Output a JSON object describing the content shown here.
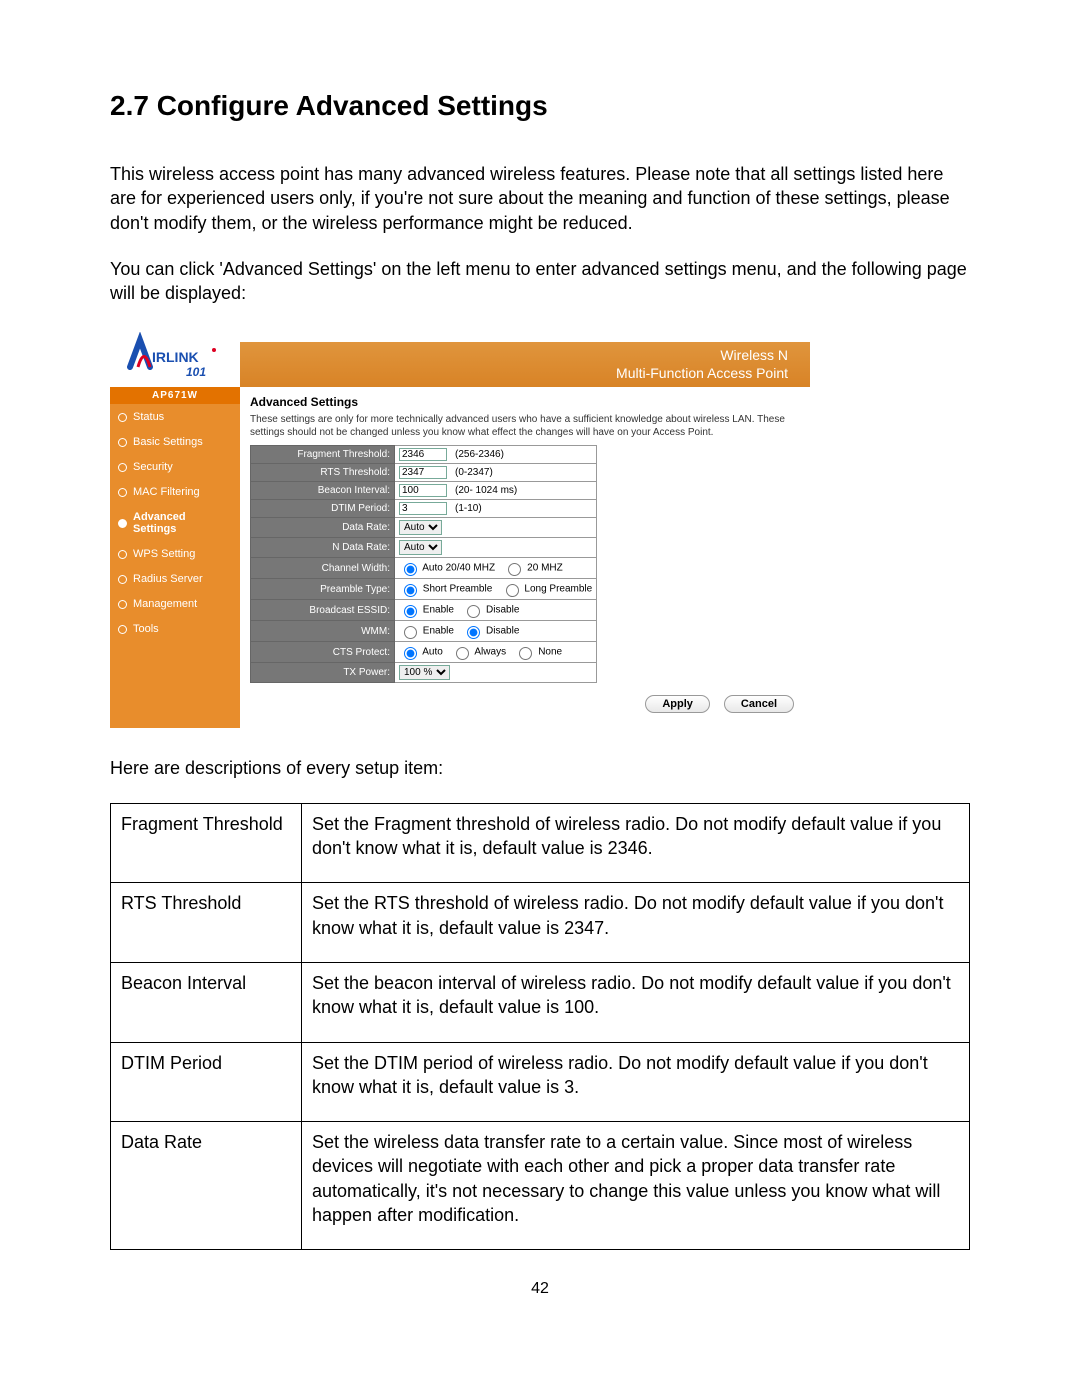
{
  "section": {
    "title": "2.7 Configure Advanced Settings",
    "p1": "This wireless access point has many advanced wireless features. Please note that all settings listed here are for experienced users only, if you're not sure about the meaning and function of these settings, please don't modify them, or the wireless performance might be reduced.",
    "p2": "You can click 'Advanced Settings' on the left menu to enter advanced settings menu, and the following page will be displayed:",
    "p3": "Here are descriptions of every setup item:",
    "pagenum": "42"
  },
  "router": {
    "brand_line1": "Wireless N",
    "brand_line2": "Multi-Function Access Point",
    "model": "AP671W",
    "nav": [
      {
        "label": "Status",
        "active": false
      },
      {
        "label": "Basic Settings",
        "active": false
      },
      {
        "label": "Security",
        "active": false
      },
      {
        "label": "MAC Filtering",
        "active": false
      },
      {
        "label": "Advanced Settings",
        "active": true
      },
      {
        "label": "WPS Setting",
        "active": false
      },
      {
        "label": "Radius Server",
        "active": false
      },
      {
        "label": "Management",
        "active": false
      },
      {
        "label": "Tools",
        "active": false
      }
    ],
    "content": {
      "heading": "Advanced Settings",
      "desc": "These settings are only for more technically advanced users who have a sufficient knowledge about wireless LAN. These settings should not be changed unless you know what effect the changes will have on your Access Point.",
      "rows": {
        "frag_label": "Fragment Threshold:",
        "frag_value": "2346",
        "frag_hint": "(256-2346)",
        "rts_label": "RTS Threshold:",
        "rts_value": "2347",
        "rts_hint": "(0-2347)",
        "beacon_label": "Beacon Interval:",
        "beacon_value": "100",
        "beacon_hint": "(20- 1024 ms)",
        "dtim_label": "DTIM Period:",
        "dtim_value": "3",
        "dtim_hint": "(1-10)",
        "data_label": "Data Rate:",
        "data_value": "Auto",
        "ndata_label": "N Data Rate:",
        "ndata_value": "Auto",
        "chw_label": "Channel Width:",
        "chw_opt1": "Auto 20/40 MHZ",
        "chw_opt2": "20 MHZ",
        "pre_label": "Preamble Type:",
        "pre_opt1": "Short Preamble",
        "pre_opt2": "Long Preamble",
        "bssid_label": "Broadcast ESSID:",
        "bssid_opt1": "Enable",
        "bssid_opt2": "Disable",
        "wmm_label": "WMM:",
        "wmm_opt1": "Enable",
        "wmm_opt2": "Disable",
        "cts_label": "CTS Protect:",
        "cts_opt1": "Auto",
        "cts_opt2": "Always",
        "cts_opt3": "None",
        "tx_label": "TX Power:",
        "tx_value": "100 %"
      },
      "apply": "Apply",
      "cancel": "Cancel"
    }
  },
  "table": [
    {
      "name": "Fragment Threshold",
      "desc": "Set the Fragment threshold of wireless radio. Do not modify default value if you don't know what it is, default value is 2346."
    },
    {
      "name": "RTS Threshold",
      "desc": "Set the RTS threshold of wireless radio. Do not modify default value if you don't know what it is, default value is 2347."
    },
    {
      "name": "Beacon Interval",
      "desc": "Set the beacon interval of wireless radio. Do not modify default value if you don't know what it is, default value is 100."
    },
    {
      "name": "DTIM Period",
      "desc": "Set the DTIM period of wireless radio. Do not modify default value if you don't know what it is, default value is 3."
    },
    {
      "name": "Data Rate",
      "desc": "Set the wireless data transfer rate to a certain value. Since most of wireless devices will negotiate with each other and pick a proper data transfer rate automatically, it's not necessary to change this value unless you know what will happen after modification."
    }
  ]
}
